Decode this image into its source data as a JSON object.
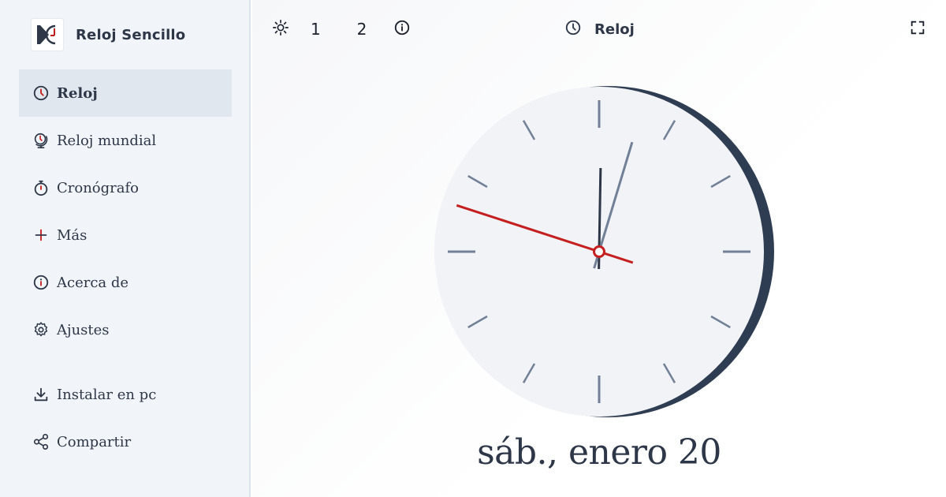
{
  "app": {
    "title": "Reloj Sencillo"
  },
  "sidebar": {
    "items": [
      {
        "label": "Reloj",
        "icon": "clock-icon",
        "active": true
      },
      {
        "label": "Reloj mundial",
        "icon": "globe-clock-icon"
      },
      {
        "label": "Cronógrafo",
        "icon": "stopwatch-icon"
      },
      {
        "label": "Más",
        "icon": "plus-icon"
      },
      {
        "label": "Acerca de",
        "icon": "info-icon"
      },
      {
        "label": "Ajustes",
        "icon": "gear-icon"
      }
    ],
    "secondary": [
      {
        "label": "Instalar en pc",
        "icon": "download-icon"
      },
      {
        "label": "Compartir",
        "icon": "share-icon"
      }
    ]
  },
  "toolbar": {
    "theme_icon": "sun-icon",
    "option_1": "1",
    "option_2": "2",
    "info_icon": "info-icon",
    "title": "Reloj",
    "fullscreen_icon": "fullscreen-icon"
  },
  "clock": {
    "hour": 12,
    "minute": 2,
    "second": 48,
    "colors": {
      "face": "#f1f3f7",
      "rim": "#2f3d52",
      "ticks": "#718096",
      "hour_hand": "#2d3748",
      "minute_hand": "#718096",
      "second_hand": "#c41e1e"
    }
  },
  "date_text": "sáb., enero 20"
}
